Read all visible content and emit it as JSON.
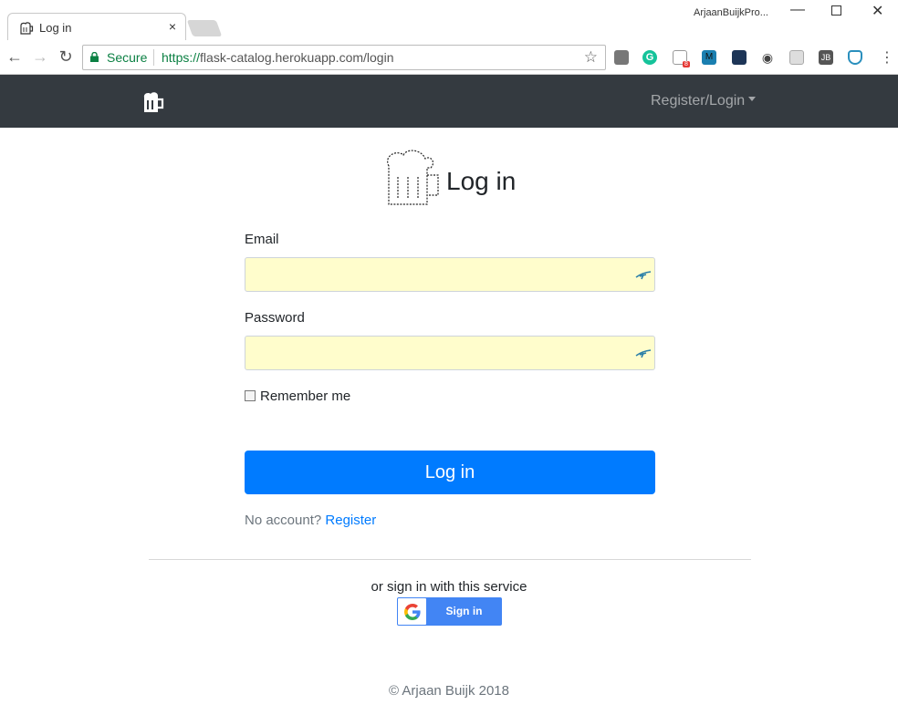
{
  "browser": {
    "tab_title": "Log in",
    "tab_close": "×",
    "profile_name": "ArjaanBuijkPro...",
    "secure_label": "Secure",
    "url_scheme": "https://",
    "url_rest": "flask-catalog.herokuapp.com/login",
    "extension_badge": "8",
    "extension_jb_label": "JB",
    "extension_m_label": "M"
  },
  "navbar": {
    "brand_icon": "beer-mug-icon",
    "dropdown_label": "Register/Login"
  },
  "page": {
    "title": "Log in",
    "email_label": "Email",
    "password_label": "Password",
    "remember_label": "Remember me",
    "remember_checked": false,
    "submit_label": "Log in",
    "no_account_text": "No account?",
    "register_link": "Register",
    "or_text": "or sign in with this service",
    "google_button_label": "Sign in",
    "footer": "© Arjaan Buijk 2018"
  },
  "colors": {
    "navbar_bg": "#343a40",
    "primary": "#007bff",
    "autofill_bg": "#fffdcc",
    "google_blue": "#4285f4"
  }
}
